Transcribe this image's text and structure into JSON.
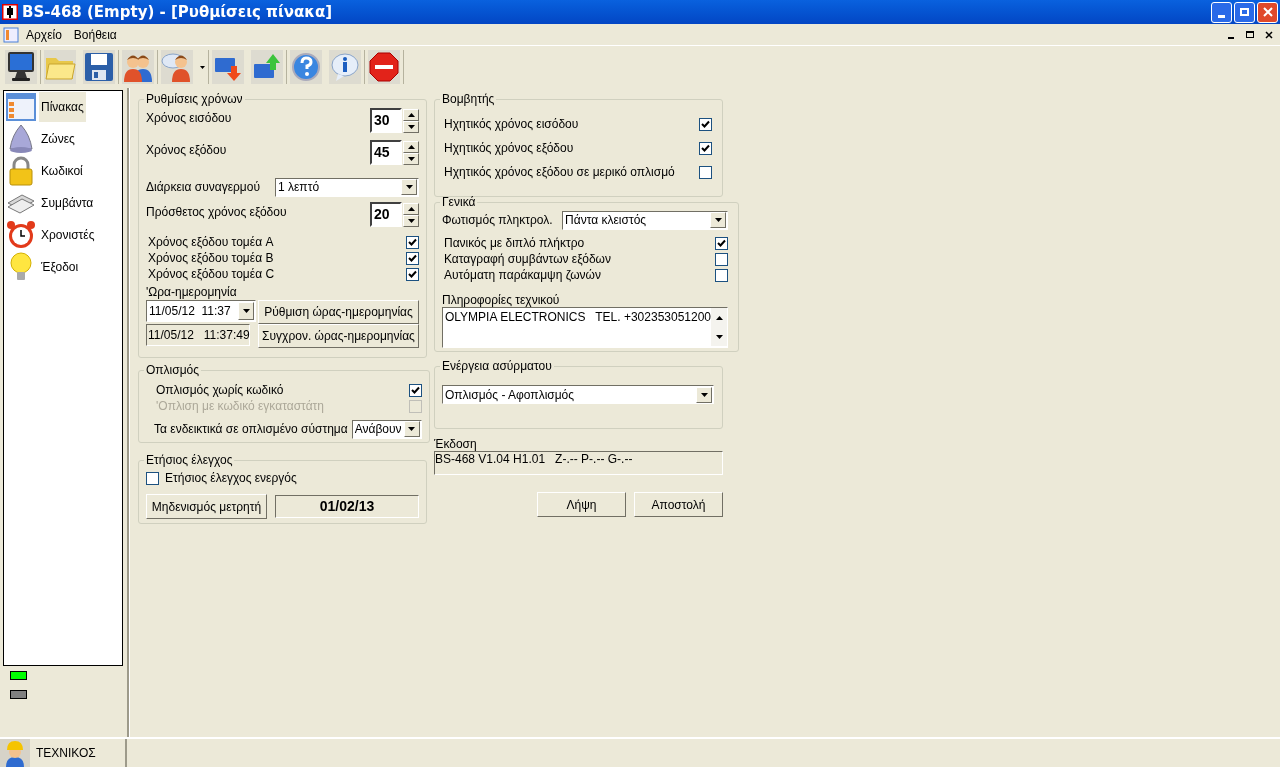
{
  "window": {
    "title": "BS-468 (Empty) - [Ρυθμίσεις πίνακα]"
  },
  "menu": [
    "Αρχείο",
    "Βοήθεια"
  ],
  "sidebar": {
    "items": [
      {
        "label": "Πίνακας",
        "selected": true
      },
      {
        "label": "Ζώνες",
        "selected": false
      },
      {
        "label": "Κωδικοί",
        "selected": false
      },
      {
        "label": "Συμβάντα",
        "selected": false
      },
      {
        "label": "Χρονιστές",
        "selected": false
      },
      {
        "label": "Έξοδοι",
        "selected": false
      }
    ],
    "indicators": [
      {
        "color": "#00ff00"
      },
      {
        "color": "#808080"
      }
    ]
  },
  "time_settings": {
    "title": "Ρυθμίσεις χρόνων",
    "rows": [
      {
        "kind": "spinner",
        "label": "Χρόνος εισόδου",
        "value": "30"
      },
      {
        "kind": "spinner",
        "label": "Χρόνος εξόδου",
        "value": "45"
      },
      {
        "kind": "select",
        "label": "Διάρκεια συναγερμού",
        "value": "1 λεπτό"
      },
      {
        "kind": "spinner",
        "label": "Πρόσθετος χρόνος εξόδου",
        "value": "20"
      },
      {
        "kind": "checkbox",
        "label": "Χρόνος εξόδου τομέα A",
        "checked": true
      },
      {
        "kind": "checkbox",
        "label": "Χρόνος εξόδου τομέα B",
        "checked": true
      },
      {
        "kind": "checkbox",
        "label": "Χρόνος εξόδου τομέα C",
        "checked": true
      }
    ],
    "datetime": {
      "label": "'Ωρα-ημερομηνία",
      "picker_value": "11/05/12  11:37",
      "current_value": "11/05/12   11:37:49",
      "buttons": [
        "Ρύθμιση ώρας-ημερομηνίας",
        "Συγχρον. ώρας-ημερομηνίας"
      ]
    }
  },
  "arming": {
    "title": "Οπλισμός",
    "rows": [
      {
        "kind": "checkbox",
        "label": "Οπλισμός χωρίς κωδικό",
        "checked": true,
        "disabled": false
      },
      {
        "kind": "checkbox",
        "label": "'Οπλιση με κωδικό εγκαταστάτη",
        "checked": false,
        "disabled": true
      },
      {
        "kind": "select",
        "label": "Τα ενδεικτικά σε οπλισμένο σύστημα",
        "value": "Ανάβουν"
      }
    ]
  },
  "annual_check": {
    "title": "Ετήσιος έλεγχος",
    "checkbox": {
      "label": "Ετήσιος έλεγχος ενεργός",
      "checked": false
    },
    "reset_button": "Μηδενισμός μετρητή",
    "date": "01/02/13"
  },
  "buzzer": {
    "title": "Βομβητής",
    "rows": [
      {
        "kind": "checkbox",
        "label": "Ηχητικός χρόνος εισόδου",
        "checked": true
      },
      {
        "kind": "checkbox",
        "label": "Ηχητικός χρόνος εξόδου",
        "checked": true
      },
      {
        "kind": "checkbox",
        "label": "Ηχητικός χρόνος εξόδου σε μερικό οπλισμό",
        "checked": false
      }
    ]
  },
  "general": {
    "title": "Γενικά",
    "rows": [
      {
        "kind": "select",
        "label": "Φωτισμός πληκτρολ.",
        "value": "Πάντα κλειστός"
      },
      {
        "kind": "checkbox",
        "label": "Πανικός με διπλό πλήκτρο",
        "checked": true
      },
      {
        "kind": "checkbox",
        "label": "Καταγραφή συμβάντων εξόδων",
        "checked": false
      },
      {
        "kind": "checkbox",
        "label": "Αυτόματη παράκαμψη ζωνών",
        "checked": false
      }
    ],
    "technician_info": {
      "label": "Πληροφορίες τεχνικού",
      "value": "OLYMPIA ELECTRONICS   TEL. +302353051200"
    }
  },
  "wireless": {
    "title": "Ενέργεια ασύρματου",
    "value": "Οπλισμός - Αφοπλισμός"
  },
  "version": {
    "label": "Έκδοση",
    "value": "BS-468 V1.04 H1.01   Z-.-- P-.-- G-.--"
  },
  "buttons": [
    "Λήψη",
    "Αποστολή"
  ],
  "status_bar": {
    "user": "ΤΕΧΝΙΚΟΣ"
  }
}
